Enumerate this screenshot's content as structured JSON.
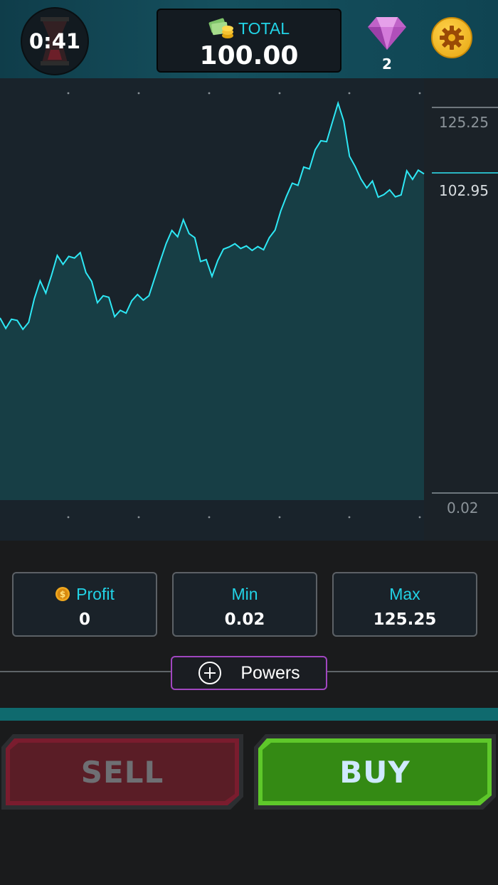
{
  "header": {
    "timer": "0:41",
    "total_label": "TOTAL",
    "total_value": "100.00",
    "gem_count": "2"
  },
  "chart": {
    "line_color": "#2ee8f5",
    "fill_color": "#173e45",
    "y_labels": {
      "max": "125.25",
      "current": "102.95",
      "min": "0.02"
    }
  },
  "chart_data": {
    "type": "area",
    "y_labels": [
      "125.25",
      "102.95",
      "0.02"
    ],
    "max": 125.25,
    "current": 102.95,
    "min": 0.02,
    "grid": false,
    "values": [
      57.5,
      54.2,
      57.1,
      56.7,
      53.9,
      56.1,
      63.6,
      69.2,
      65.3,
      71.0,
      77.2,
      74.4,
      76.9,
      76.4,
      78.1,
      71.8,
      69.0,
      62.3,
      64.5,
      64.0,
      57.9,
      59.9,
      59.0,
      62.9,
      64.9,
      63.1,
      64.5,
      70.1,
      75.6,
      81.0,
      85.1,
      83.1,
      88.5,
      84.1,
      82.8,
      75.3,
      75.9,
      70.6,
      75.6,
      79.2,
      79.9,
      80.9,
      79.4,
      80.2,
      78.8,
      80.0,
      79.0,
      82.8,
      85.2,
      91.2,
      95.9,
      100.0,
      99.3,
      105.1,
      104.5,
      110.5,
      113.4,
      113.1,
      119.2,
      125.25,
      119.6,
      108.5,
      105.2,
      101.3,
      98.5,
      100.7,
      95.6,
      96.4,
      97.9,
      95.7,
      96.3,
      103.9,
      101.2,
      104.1,
      102.95
    ]
  },
  "stats": {
    "profit": {
      "label": "Profit",
      "value": "0"
    },
    "min": {
      "label": "Min",
      "value": "0.02"
    },
    "max": {
      "label": "Max",
      "value": "125.25"
    }
  },
  "powers": {
    "label": "Powers"
  },
  "actions": {
    "sell_label": "SELL",
    "buy_label": "BUY"
  },
  "colors": {
    "accent": "#22d3e6",
    "sell": "#5a1d26",
    "buy": "#348a14",
    "powers_border": "#a046c0"
  }
}
